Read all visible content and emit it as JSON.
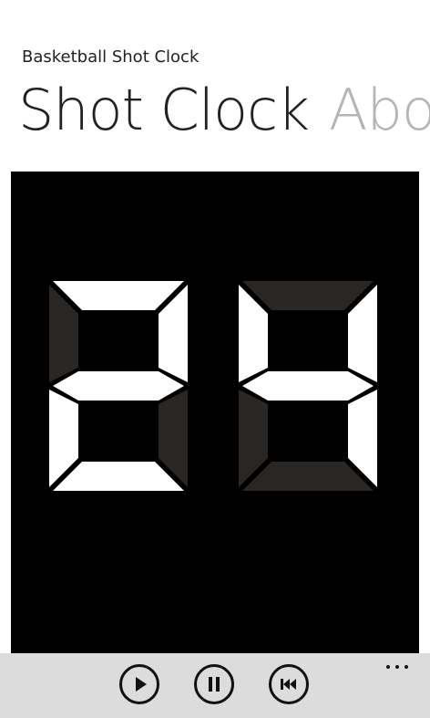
{
  "app": {
    "title": "Basketball Shot Clock"
  },
  "pivot": {
    "items": [
      {
        "label": "Shot Clock",
        "active": true
      },
      {
        "label": "About",
        "active": false
      }
    ]
  },
  "clock": {
    "value": "24",
    "digits": [
      2,
      4
    ],
    "colors": {
      "background": "#000000",
      "segment_on": "#ffffff",
      "segment_off": "#2a2624"
    }
  },
  "app_bar": {
    "buttons": [
      {
        "name": "play",
        "icon": "play-icon"
      },
      {
        "name": "pause",
        "icon": "pause-icon"
      },
      {
        "name": "reset",
        "icon": "skip-back-icon"
      }
    ],
    "more_icon": "ellipsis-icon",
    "colors": {
      "background": "#dcdcdc",
      "icon": "#111111"
    }
  }
}
